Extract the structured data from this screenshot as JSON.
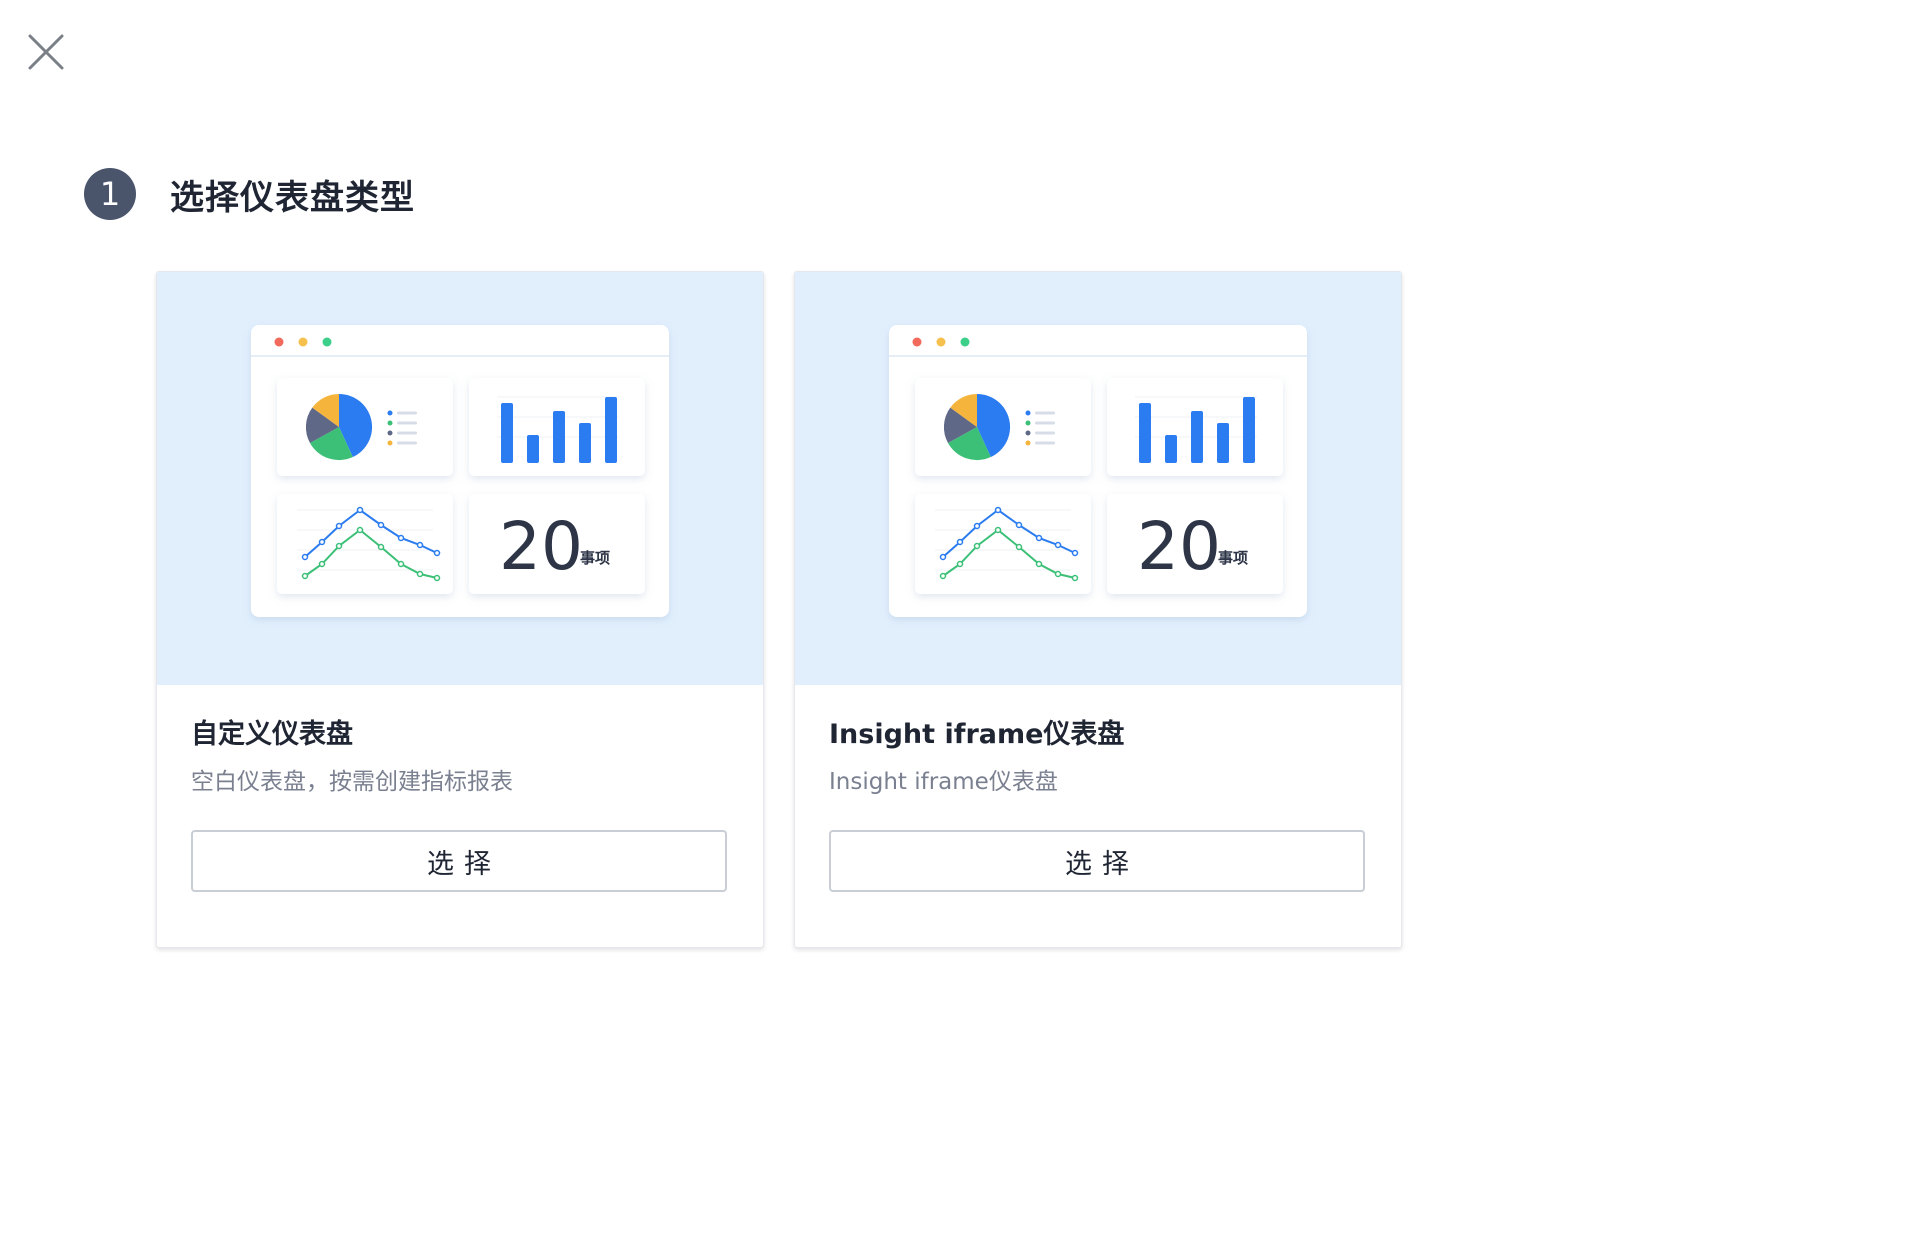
{
  "step": {
    "number": "1",
    "title": "选择仪表盘类型"
  },
  "colors": {
    "preview_bg": "#e1effd",
    "accent_blue": "#2b7cf0",
    "green": "#3cc077",
    "amber": "#f5b53d",
    "slate": "#5f6987",
    "badge": "#4a546b"
  },
  "preview": {
    "kpi_value": "20",
    "kpi_unit": "事项"
  },
  "cards": [
    {
      "title": "自定义仪表盘",
      "description": "空白仪表盘，按需创建指标报表",
      "button_label": "选择"
    },
    {
      "title": "Insight iframe仪表盘",
      "description": "Insight iframe仪表盘",
      "button_label": "选择"
    }
  ]
}
